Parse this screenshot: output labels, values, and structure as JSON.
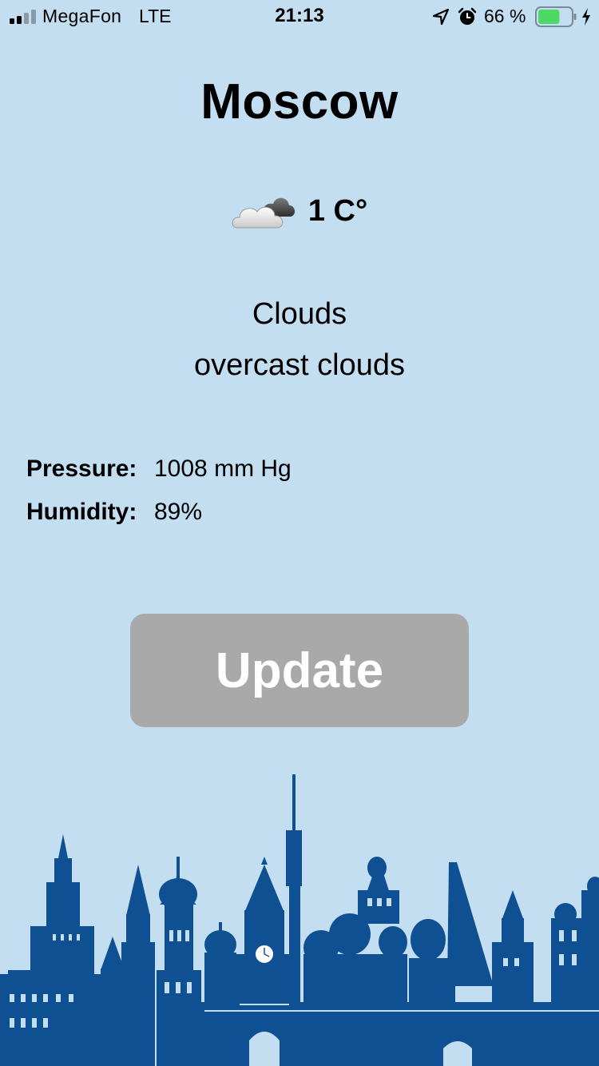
{
  "status_bar": {
    "carrier": "MegaFon",
    "network": "LTE",
    "time": "21:13",
    "battery_percent": "66 %",
    "battery_level": 0.66,
    "battery_color": "#4cd964",
    "icons": [
      "signal-icon",
      "location-arrow-icon",
      "alarm-clock-icon",
      "battery-icon",
      "charging-bolt-icon"
    ]
  },
  "weather": {
    "city": "Moscow",
    "icon": "cloud-icon",
    "temperature": "1 C°",
    "main": "Clouds",
    "description": "overcast clouds"
  },
  "stats": {
    "pressure_label": "Pressure:",
    "pressure_value": "1008 mm Hg",
    "humidity_label": "Humidity:",
    "humidity_value": "89%"
  },
  "actions": {
    "update_label": "Update"
  },
  "theme": {
    "background": "#c3def0",
    "button": "#a9a9a9",
    "skyline": "#0f5092"
  }
}
